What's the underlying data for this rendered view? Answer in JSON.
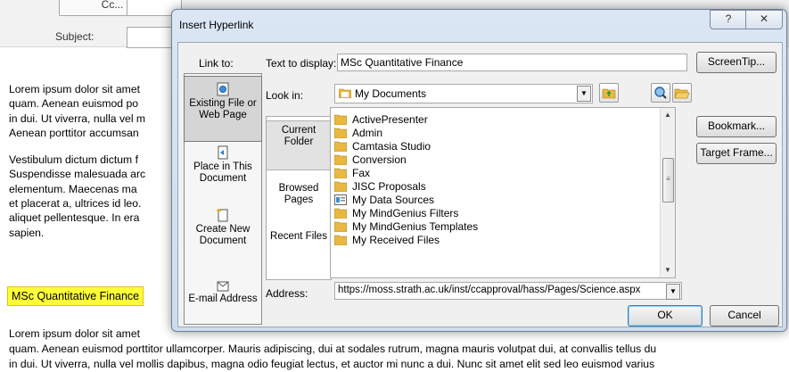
{
  "email": {
    "cc_button": "Cc...",
    "subject_label": "Subject:",
    "paragraphs": [
      [
        "Lorem ipsum dolor sit amet",
        "quam. Aenean euismod po",
        "in dui. Ut viverra, nulla vel m",
        "Aenean porttitor accumsan"
      ],
      [
        "Vestibulum dictum dictum f",
        "Suspendisse malesuada arc",
        "elementum. Maecenas ma",
        "et placerat a, ultrices id leo.",
        "aliquet pellentesque. In era",
        "sapien."
      ]
    ],
    "highlighted_link": "MSc Quantitative Finance",
    "bottom_lines": [
      "Lorem ipsum dolor sit amet",
      "quam. Aenean euismod porttitor ullamcorper. Mauris adipiscing, dui at sodales rutrum, magna mauris volutpat dui, at convallis tellus du",
      "in dui. Ut viverra, nulla vel mollis dapibus, magna odio feugiat lectus, et auctor mi nunc a dui. Nunc sit amet elit sed leo euismod varius"
    ]
  },
  "dialog": {
    "title": "Insert Hyperlink",
    "help_label": "?",
    "close_label": "✕",
    "link_to_label": "Link to:",
    "places": [
      {
        "label": "Existing File or Web Page",
        "icon": "web-page-icon",
        "selected": true
      },
      {
        "label": "Place in This Document",
        "icon": "document-place-icon",
        "selected": false
      },
      {
        "label": "Create New Document",
        "icon": "new-document-icon",
        "selected": false
      },
      {
        "label": "E-mail Address",
        "icon": "email-icon",
        "selected": false
      }
    ],
    "text_to_display_label": "Text to display:",
    "text_to_display_value": "MSc Quantitative Finance",
    "screentip_button": "ScreenTip...",
    "look_in_label": "Look in:",
    "look_in_value": "My Documents",
    "sub_places": [
      {
        "label": "Current Folder",
        "selected": true
      },
      {
        "label": "Browsed Pages",
        "selected": false
      },
      {
        "label": "Recent Files",
        "selected": false
      }
    ],
    "files": [
      {
        "name": "ActivePresenter",
        "icon": "folder-icon"
      },
      {
        "name": "Admin",
        "icon": "folder-icon"
      },
      {
        "name": "Camtasia Studio",
        "icon": "folder-icon"
      },
      {
        "name": "Conversion",
        "icon": "folder-icon"
      },
      {
        "name": "Fax",
        "icon": "folder-icon"
      },
      {
        "name": "JISC Proposals",
        "icon": "folder-icon"
      },
      {
        "name": "My Data Sources",
        "icon": "data-sources-icon"
      },
      {
        "name": "My MindGenius Filters",
        "icon": "folder-icon"
      },
      {
        "name": "My MindGenius Templates",
        "icon": "folder-icon"
      },
      {
        "name": "My Received Files",
        "icon": "folder-icon"
      }
    ],
    "bookmark_button": "Bookmark...",
    "target_frame_button": "Target Frame...",
    "address_label": "Address:",
    "address_value": "https://moss.strath.ac.uk/inst/ccapproval/hass/Pages/Science.aspx",
    "ok_button": "OK",
    "cancel_button": "Cancel"
  },
  "colors": {
    "highlight": "#ffff38",
    "folder": "#e8b842",
    "accent": "#3c7fb1"
  }
}
